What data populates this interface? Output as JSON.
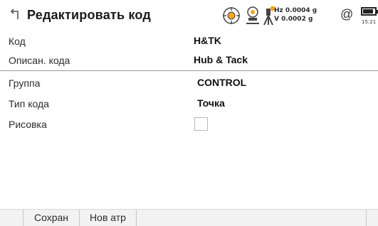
{
  "header": {
    "title": "Редактировать  код",
    "back_icon": "back-arrow-icon",
    "status": {
      "hz_line": "Hz 0.0004 g",
      "v_line": "V  0.0002 g",
      "at_symbol": "@",
      "time": "15:21",
      "accent_color": "#f5a623"
    }
  },
  "fields": {
    "code": {
      "label": "Код",
      "value": "H&TK"
    },
    "code_desc": {
      "label": "Описан. кода",
      "value": "Hub & Tack"
    },
    "group": {
      "label": "Группа",
      "value": "CONTROL"
    },
    "code_type": {
      "label": "Тип кода",
      "value": "Точка"
    },
    "drawing": {
      "label": "Рисовка",
      "checked": false
    }
  },
  "softkeys": {
    "save": "Сохран",
    "new_attr": "Нов атр"
  }
}
